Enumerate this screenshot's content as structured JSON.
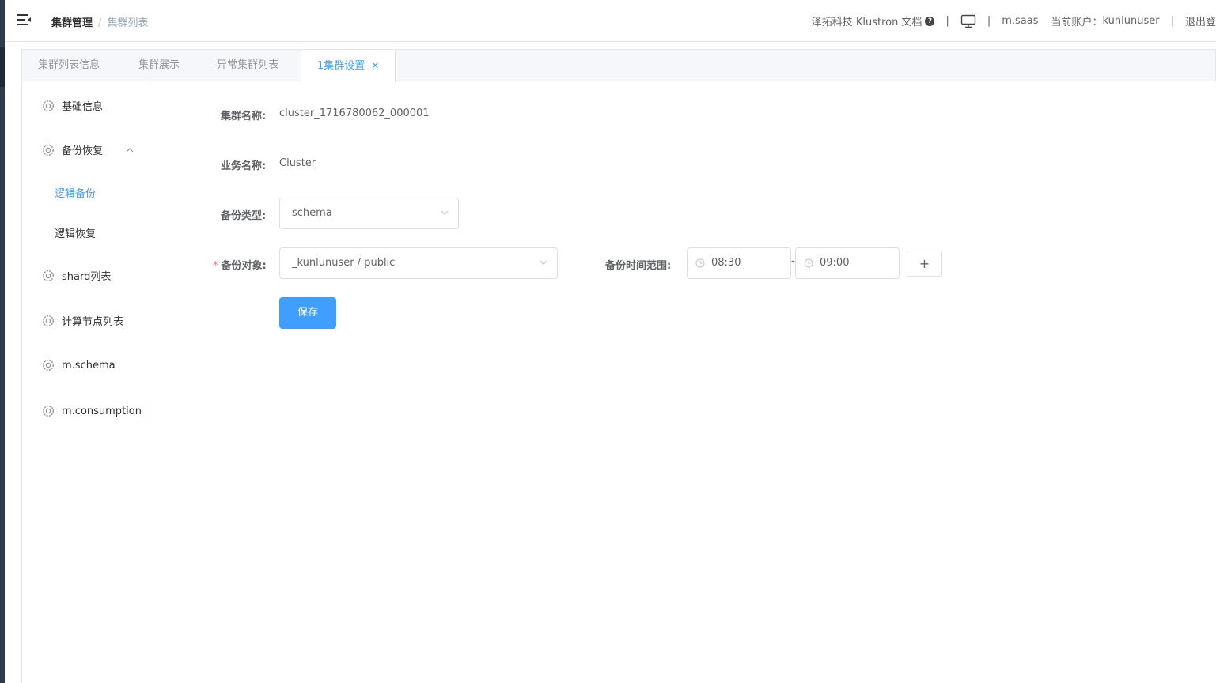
{
  "header": {
    "breadcrumb": [
      "集群管理",
      "集群列表"
    ],
    "breadcrumb_separator": "/",
    "docs_link": "泽拓科技 Klustron 文档",
    "separator": "|",
    "user": "m.saas",
    "account_label": "当前账户：",
    "account_name": "kunlunuser",
    "logout": "退出登"
  },
  "tabs": [
    {
      "label": "集群列表信息"
    },
    {
      "label": "集群展示"
    },
    {
      "label": "异常集群列表"
    },
    {
      "label": "1集群设置",
      "close": "✕"
    }
  ],
  "sidebar": {
    "items": [
      {
        "label": "基础信息"
      },
      {
        "label": "备份恢复"
      },
      {
        "label": "逻辑备份"
      },
      {
        "label": "逻辑恢复"
      },
      {
        "label": "shard列表"
      },
      {
        "label": "计算节点列表"
      },
      {
        "label": "m.schema"
      },
      {
        "label": "m.consumption"
      }
    ]
  },
  "form": {
    "cluster_name_label": "集群名称:",
    "cluster_name_value": "cluster_1716780062_000001",
    "business_name_label": "业务名称:",
    "business_name_value": "Cluster",
    "backup_type_label": "备份类型:",
    "backup_type_value": "schema",
    "required_mark": "*",
    "backup_target_label": "备份对象:",
    "backup_target_value": "_kunlunuser / public",
    "time_range_label": "备份时间范围:",
    "time_start": "08:30",
    "time_sep": "-",
    "time_end": "09:00",
    "add_button": "+",
    "save_button": "保存"
  },
  "colors": {
    "accent": "#409eff",
    "required": "#f56c6c"
  }
}
